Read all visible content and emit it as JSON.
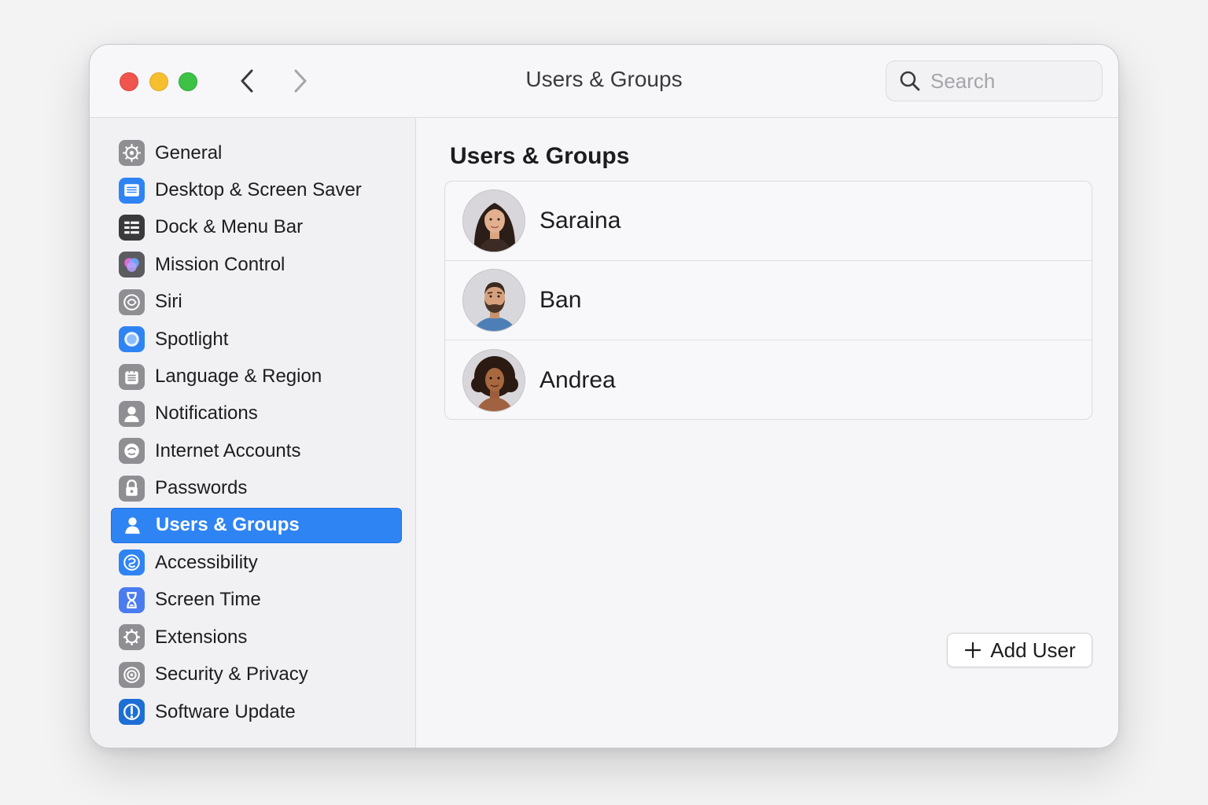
{
  "window": {
    "title": "Users & Groups"
  },
  "search": {
    "placeholder": "Search"
  },
  "sidebar": {
    "items": [
      {
        "label": "General",
        "icon": "gear-icon",
        "color": "#8e8e93",
        "selected": false
      },
      {
        "label": "Desktop & Screen Saver",
        "icon": "desktop-icon",
        "color": "#2f84f3",
        "selected": false
      },
      {
        "label": "Dock & Menu Bar",
        "icon": "dock-icon",
        "color": "#3a3a3c",
        "selected": false
      },
      {
        "label": "Mission Control",
        "icon": "mission-control-icon",
        "color": "#5b5b60",
        "selected": false
      },
      {
        "label": "Siri",
        "icon": "siri-icon",
        "color": "#8e8e93",
        "selected": false
      },
      {
        "label": "Spotlight",
        "icon": "spotlight-icon",
        "color": "#2f84f3",
        "selected": false
      },
      {
        "label": "Language & Region",
        "icon": "language-icon",
        "color": "#8e8e93",
        "selected": false
      },
      {
        "label": "Notifications",
        "icon": "notifications-icon",
        "color": "#8e8e93",
        "selected": false
      },
      {
        "label": "Internet Accounts",
        "icon": "internet-accounts-icon",
        "color": "#8e8e93",
        "selected": false
      },
      {
        "label": "Passwords",
        "icon": "lock-icon",
        "color": "#8e8e93",
        "selected": false
      },
      {
        "label": "Users & Groups",
        "icon": "user-icon",
        "color": "#2f84f3",
        "selected": true
      },
      {
        "label": "Accessibility",
        "icon": "accessibility-icon",
        "color": "#2f84f3",
        "selected": false
      },
      {
        "label": "Screen Time",
        "icon": "hourglass-icon",
        "color": "#4a7cf0",
        "selected": false
      },
      {
        "label": "Extensions",
        "icon": "puzzle-gear-icon",
        "color": "#8e8e93",
        "selected": false
      },
      {
        "label": "Security & Privacy",
        "icon": "shield-icon",
        "color": "#8e8e93",
        "selected": false
      },
      {
        "label": "Software Update",
        "icon": "update-icon",
        "color": "#1d6fd6",
        "selected": false
      }
    ]
  },
  "main": {
    "section_title": "Users & Groups",
    "users": [
      {
        "name": "Saraina",
        "avatar": "avatar-woman-long-hair"
      },
      {
        "name": "Ban",
        "avatar": "avatar-man-beard"
      },
      {
        "name": "Andrea",
        "avatar": "avatar-woman-curly-hair"
      }
    ],
    "add_user_label": "Add User"
  },
  "colors": {
    "accent": "#2f84f3",
    "traffic_red": "#f0544c",
    "traffic_yellow": "#f6bf2f",
    "traffic_green": "#3dc246"
  }
}
